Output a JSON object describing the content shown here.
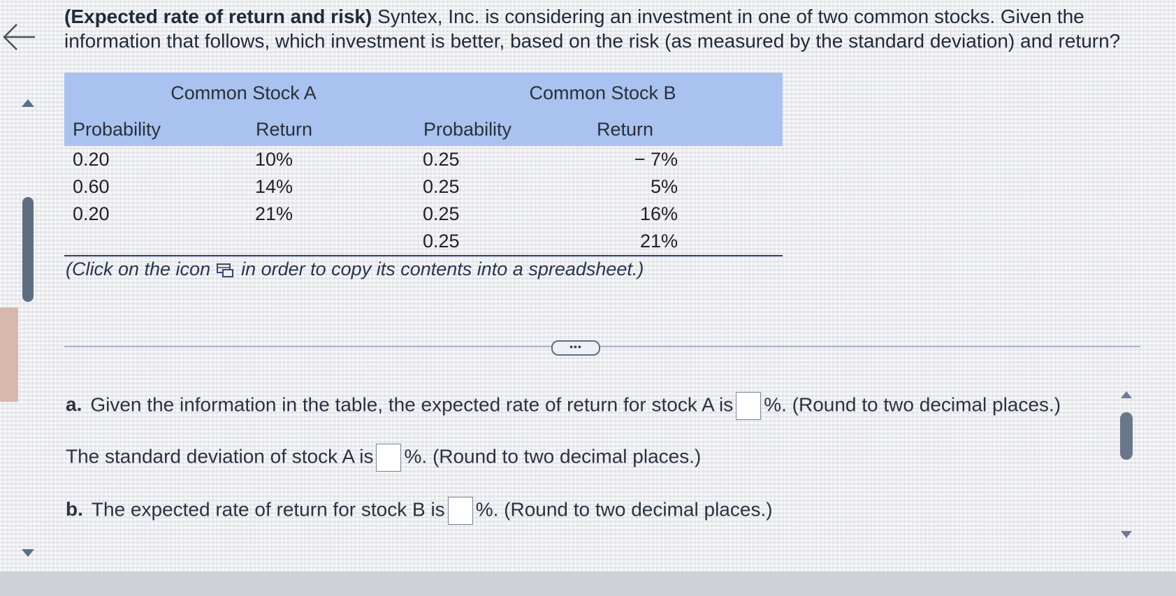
{
  "question": {
    "title_bold": "(Expected rate of return and risk)",
    "text": " Syntex, Inc. is considering an investment in one of two common stocks.  Given the information that follows, which investment is better, based on the risk (as measured by the standard deviation) and return?"
  },
  "table": {
    "group_headers": [
      "Common Stock A",
      "Common Stock B"
    ],
    "column_headers": [
      "Probability",
      "Return",
      "Probability",
      "Return"
    ],
    "rows": [
      [
        "0.20",
        "10%",
        "0.25",
        "− 7%"
      ],
      [
        "0.60",
        "14%",
        "0.25",
        "5%"
      ],
      [
        "0.20",
        "21%",
        "0.25",
        "16%"
      ],
      [
        "",
        "",
        "0.25",
        "21%"
      ]
    ]
  },
  "note": {
    "before": "(Click on the icon",
    "after": "in order to copy its contents into a spreadsheet.)"
  },
  "expand_button_label": "•••",
  "parts": {
    "a_label": "a.",
    "a_text": "Given the information in the table, the expected rate of return for stock A is",
    "a_suffix": "%.  (Round to two decimal places.)",
    "a2_text": "The standard deviation of stock A is",
    "a2_suffix": "%.  (Round to two decimal places.)",
    "b_label": "b.",
    "b_text": "The expected rate of return for stock B is",
    "b_suffix": "%.  (Round to two decimal places.)"
  },
  "colors": {
    "table_header_bg": "#a9c2ef",
    "table_rule": "#2c3f6a",
    "scroll_thumb": "#5e6d80"
  },
  "icons": [
    "back-arrow-icon",
    "copy-spreadsheet-icon",
    "scroll-up-icon",
    "scroll-down-icon"
  ]
}
